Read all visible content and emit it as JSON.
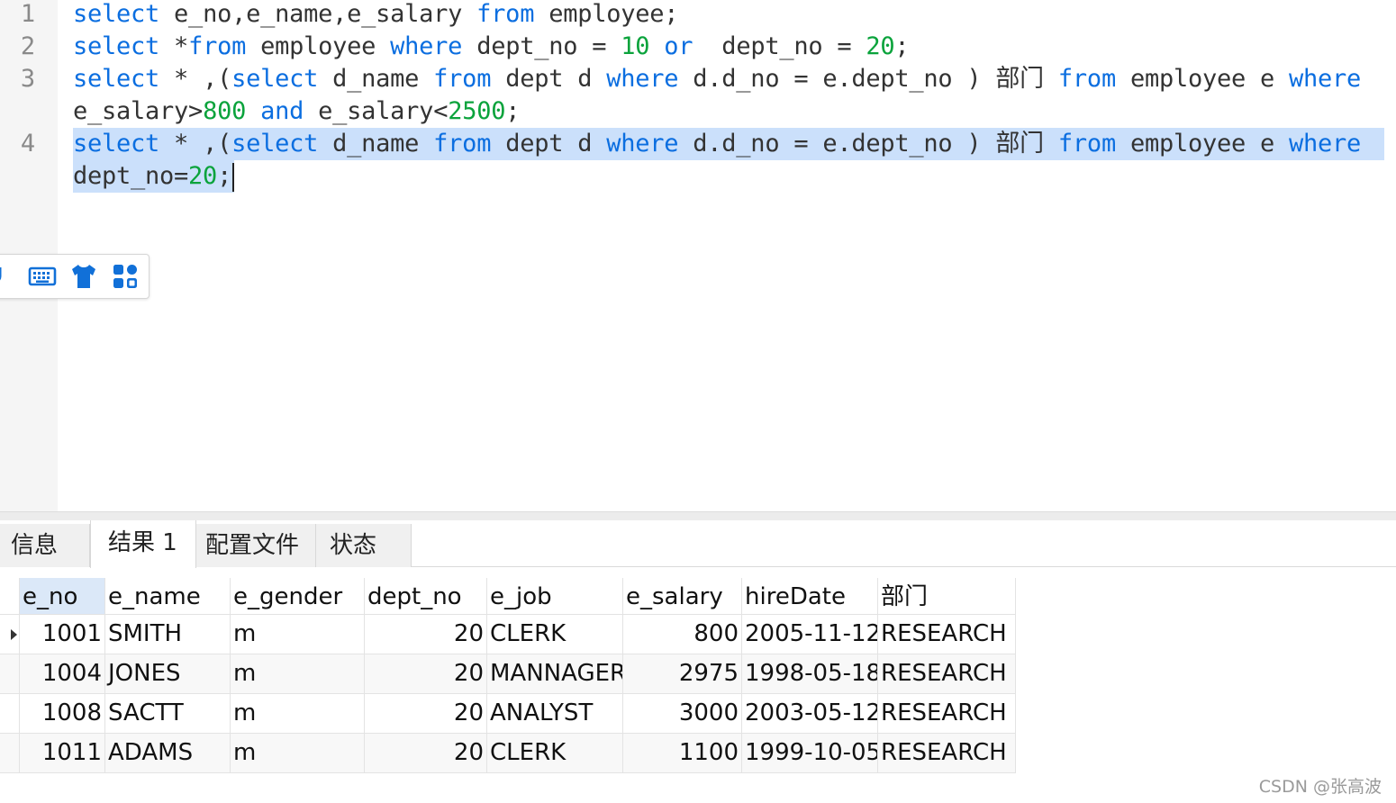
{
  "editor": {
    "lines": [
      {
        "num": "1",
        "tokens": [
          {
            "t": "select",
            "k": "kw"
          },
          {
            "t": " e_no,e_name,e_salary "
          },
          {
            "t": "from",
            "k": "kw"
          },
          {
            "t": " employee;"
          }
        ]
      },
      {
        "num": "2",
        "tokens": [
          {
            "t": "select",
            "k": "kw"
          },
          {
            "t": " *"
          },
          {
            "t": "from",
            "k": "kw"
          },
          {
            "t": " employee "
          },
          {
            "t": "where",
            "k": "kw"
          },
          {
            "t": " dept_no = "
          },
          {
            "t": "10",
            "k": "num"
          },
          {
            "t": " "
          },
          {
            "t": "or",
            "k": "kw"
          },
          {
            "t": "  dept_no = "
          },
          {
            "t": "20",
            "k": "num"
          },
          {
            "t": ";"
          }
        ]
      },
      {
        "num": "3",
        "tokens": [
          {
            "t": "select",
            "k": "kw"
          },
          {
            "t": " * ,("
          },
          {
            "t": "select",
            "k": "kw"
          },
          {
            "t": " d_name "
          },
          {
            "t": "from",
            "k": "kw"
          },
          {
            "t": " dept d "
          },
          {
            "t": "where",
            "k": "kw"
          },
          {
            "t": " d.d_no = e.dept_no ) "
          },
          {
            "t": "部门",
            "k": "cjk"
          },
          {
            "t": " "
          },
          {
            "t": "from",
            "k": "kw"
          },
          {
            "t": " employee e "
          },
          {
            "t": "where",
            "k": "kw"
          }
        ]
      },
      {
        "num": "",
        "tokens": [
          {
            "t": "e_salary>"
          },
          {
            "t": "800",
            "k": "num"
          },
          {
            "t": " "
          },
          {
            "t": "and",
            "k": "kw"
          },
          {
            "t": " e_salary<"
          },
          {
            "t": "2500",
            "k": "num"
          },
          {
            "t": ";"
          }
        ]
      },
      {
        "num": "4",
        "highlight": true,
        "tokens": [
          {
            "t": "select",
            "k": "kw"
          },
          {
            "t": " * ,("
          },
          {
            "t": "select",
            "k": "kw"
          },
          {
            "t": " d_name "
          },
          {
            "t": "from",
            "k": "kw"
          },
          {
            "t": " dept d "
          },
          {
            "t": "where",
            "k": "kw"
          },
          {
            "t": " d.d_no = e.dept_no ) "
          },
          {
            "t": "部门",
            "k": "cjk"
          },
          {
            "t": " "
          },
          {
            "t": "from",
            "k": "kw"
          },
          {
            "t": " employee e "
          },
          {
            "t": "where",
            "k": "kw"
          },
          {
            "t": " "
          }
        ]
      },
      {
        "num": "",
        "highlight": true,
        "caret": true,
        "tokens": [
          {
            "t": "dept_no="
          },
          {
            "t": "20",
            "k": "num"
          },
          {
            "t": ";"
          }
        ]
      }
    ],
    "colors": {
      "keyword": "#0b6ee0",
      "number": "#0ba33c",
      "selection": "#cbe0fb"
    }
  },
  "ime_toolbar": {
    "icons": [
      "microphone-icon",
      "keyboard-icon",
      "skin-tshirt-icon",
      "toolbox-grid-icon"
    ]
  },
  "tabs": [
    {
      "label": "信息",
      "active": false
    },
    {
      "label": "结果 1",
      "active": true
    },
    {
      "label": "配置文件",
      "active": false
    },
    {
      "label": "状态",
      "active": false
    }
  ],
  "results": {
    "columns": [
      "e_no",
      "e_name",
      "e_gender",
      "dept_no",
      "e_job",
      "e_salary",
      "hireDate",
      "部门"
    ],
    "rows": [
      [
        "1001",
        "SMITH",
        "m",
        "20",
        "CLERK",
        "800",
        "2005-11-12",
        "RESEARCH"
      ],
      [
        "1004",
        "JONES",
        "m",
        "20",
        "MANNAGER",
        "2975",
        "1998-05-18",
        "RESEARCH"
      ],
      [
        "1008",
        "SACTT",
        "m",
        "20",
        "ANALYST",
        "3000",
        "2003-05-12",
        "RESEARCH"
      ],
      [
        "1011",
        "ADAMS",
        "m",
        "20",
        "CLERK",
        "1100",
        "1999-10-05",
        "RESEARCH"
      ]
    ],
    "current_row": 0
  },
  "watermark": "CSDN @张高波"
}
